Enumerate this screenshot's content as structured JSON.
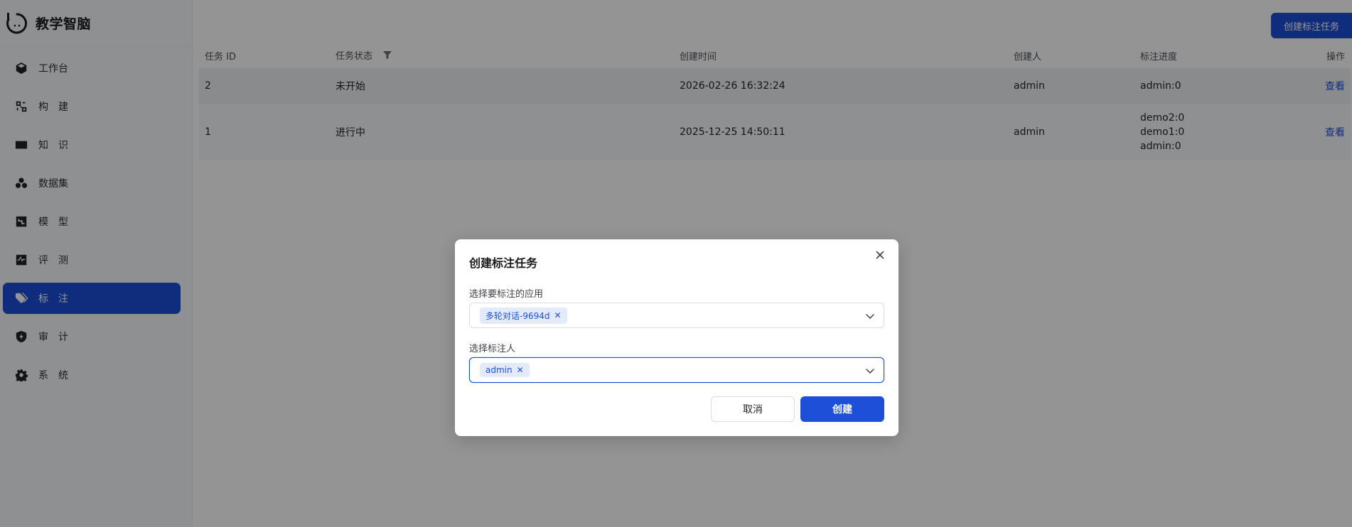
{
  "app": {
    "name": "教学智脑"
  },
  "sidebar": {
    "items": [
      {
        "label": "工作台",
        "icon": "cube-icon",
        "active": false
      },
      {
        "label": "构　建",
        "icon": "build-icon",
        "active": false
      },
      {
        "label": "知　识",
        "icon": "book-icon",
        "active": false
      },
      {
        "label": "数据集",
        "icon": "dataset-icon",
        "active": false
      },
      {
        "label": "模　型",
        "icon": "model-icon",
        "active": false
      },
      {
        "label": "评　测",
        "icon": "pulse-icon",
        "active": false
      },
      {
        "label": "标　注",
        "icon": "tag-icon",
        "active": true
      },
      {
        "label": "审　计",
        "icon": "shield-icon",
        "active": false
      },
      {
        "label": "系　统",
        "icon": "gear-icon",
        "active": false
      }
    ]
  },
  "header": {
    "create_button": "创建标注任务"
  },
  "table": {
    "columns": [
      "任务 ID",
      "任务状态",
      "创建时间",
      "创建人",
      "标注进度",
      "操作"
    ],
    "rows": [
      {
        "id": "2",
        "status": "未开始",
        "created_at": "2026-02-26 16:32:24",
        "creator": "admin",
        "progress": [
          "admin:0"
        ],
        "action": "查看"
      },
      {
        "id": "1",
        "status": "进行中",
        "created_at": "2025-12-25 14:50:11",
        "creator": "admin",
        "progress": [
          "demo2:0",
          "demo1:0",
          "admin:0"
        ],
        "action": "查看"
      }
    ]
  },
  "modal": {
    "title": "创建标注任务",
    "app_label": "选择要标注的应用",
    "app_selected": "多轮对话-9694d",
    "annotator_label": "选择标注人",
    "annotator_selected": "admin",
    "cancel": "取消",
    "confirm": "创建"
  },
  "colors": {
    "accent": "#1d4fd8",
    "overlay": "rgba(0,0,0,0.42)"
  }
}
